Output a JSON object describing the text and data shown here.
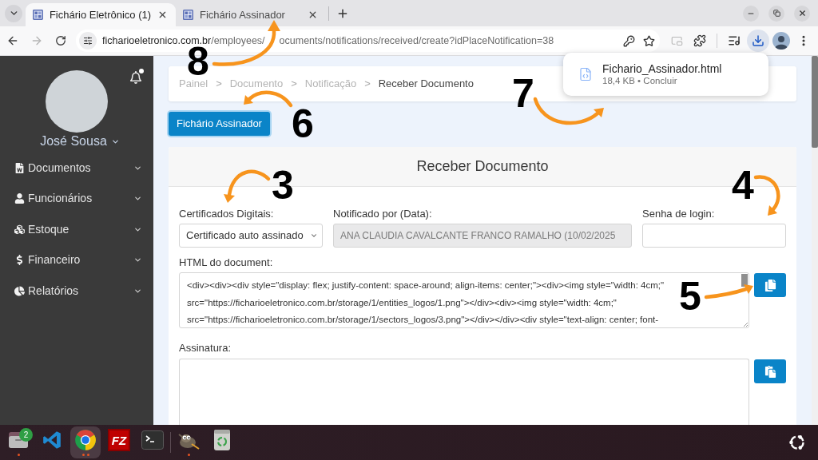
{
  "browser": {
    "tabs": [
      {
        "title": "Fichário Eletrônico (1)",
        "selected": true
      },
      {
        "title": "Fichário Assinador",
        "selected": false
      }
    ],
    "toolbar": {
      "back_disabled": false,
      "forward_disabled": true,
      "url_host": "ficharioeletronico.com.br",
      "url_path_parts": [
        "/employees/",
        "ocuments/notifications/received/create?idPlaceNotification=38"
      ],
      "downloads_open": true
    },
    "download_popup": {
      "filename": "Fichario_Assinador.html",
      "status": "18,4 KB • Concluir"
    }
  },
  "sidebar": {
    "user_name": "José Sousa",
    "notification_dot": true,
    "menu": [
      {
        "label": "Documentos"
      },
      {
        "label": "Funcionários"
      },
      {
        "label": "Estoque"
      },
      {
        "label": "Financeiro"
      },
      {
        "label": "Relatórios"
      }
    ]
  },
  "breadcrumb": [
    {
      "kind": "link",
      "label": "Painel"
    },
    {
      "kind": "separator",
      "label": ">"
    },
    {
      "kind": "link",
      "label": "Documento"
    },
    {
      "kind": "separator",
      "label": ">"
    },
    {
      "kind": "link",
      "label": "Notificação"
    },
    {
      "kind": "separator",
      "label": ">"
    },
    {
      "kind": "current",
      "label": "Receber Documento"
    }
  ],
  "signer_button": {
    "label": "Fichário Assinador"
  },
  "form": {
    "title": "Receber Documento",
    "fields": [
      {
        "kind": "select",
        "label": "Certificados Digitais:",
        "value": "Certificado auto assinado",
        "disabled": false
      },
      {
        "kind": "text",
        "label": "Notificado por (Data):",
        "value": "ANA CLAUDIA CAVALCANTE FRANCO RAMALHO (10/02/2025",
        "disabled": true
      },
      {
        "kind": "password",
        "label": "Senha de login:",
        "disabled": false
      }
    ],
    "textareas": [
      {
        "label": "HTML do document:",
        "lines": [
          "<div><div><div style=\"display: flex; justify-content: space-around; align-items: center;\"><div><img style=\"width: 4cm;\"",
          "src=\"https://ficharioeletronico.com.br/storage/1/entities_logos/1.png\"></div><div><img style=\"width: 4cm;\"",
          "src=\"https://ficharioeletronico.com.br/storage/1/sectors_logos/3.png\"></div></div><div style=\"text-align: center; font-"
        ]
      },
      {
        "label": "Assinatura:"
      }
    ]
  },
  "taskbar": {
    "apps": [
      {
        "kind": "files",
        "badge": "2",
        "running": true,
        "multiple": false,
        "focused": false
      },
      {
        "kind": "editor",
        "running": false,
        "multiple": false,
        "focused": false
      },
      {
        "kind": "browser",
        "running": true,
        "multiple": true,
        "focused": true
      },
      {
        "kind": "ftp",
        "logo_text": "FZ",
        "running": false,
        "multiple": false,
        "focused": false
      },
      {
        "kind": "terminal",
        "running": false,
        "multiple": false,
        "focused": false
      },
      {
        "kind": "separator"
      },
      {
        "kind": "image_editor",
        "running": true,
        "multiple": false,
        "focused": false
      },
      {
        "kind": "trash",
        "running": false,
        "multiple": false,
        "focused": false
      }
    ]
  },
  "annotations": [
    {
      "label": "8"
    },
    {
      "label": "7"
    },
    {
      "label": "6"
    },
    {
      "label": "3"
    },
    {
      "label": "4"
    },
    {
      "label": "5"
    }
  ]
}
